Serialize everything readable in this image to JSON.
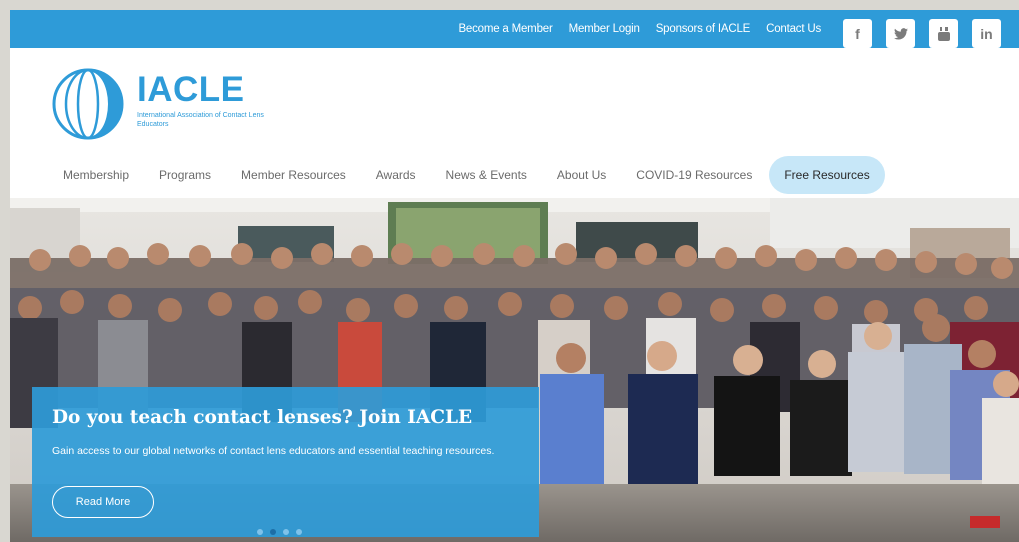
{
  "header": {
    "links": [
      "Become a Member",
      "Member Login",
      "Sponsors of IACLE",
      "Contact Us"
    ],
    "social": [
      {
        "icon": "facebook-icon",
        "glyph": "f"
      },
      {
        "icon": "twitter-icon",
        "glyph": "🐦"
      },
      {
        "icon": "youtube-icon",
        "glyph": "▣"
      },
      {
        "icon": "linkedin-icon",
        "glyph": "in"
      }
    ]
  },
  "logo": {
    "title": "IACLE",
    "subtitle": "International Association of Contact Lens Educators"
  },
  "nav": {
    "items": [
      "Membership",
      "Programs",
      "Member Resources",
      "Awards",
      "News & Events",
      "About Us",
      "COVID-19 Resources",
      "Free Resources"
    ]
  },
  "hero": {
    "title": "Do you teach contact lenses? Join IACLE",
    "text": "Gain access to our global networks of contact lens educators and essential teaching resources.",
    "button": "Read More",
    "slides_total": 4,
    "active_slide": 2
  },
  "colors": {
    "accent": "#2e9bd8",
    "free_resources_bg": "#c7e7f8"
  }
}
